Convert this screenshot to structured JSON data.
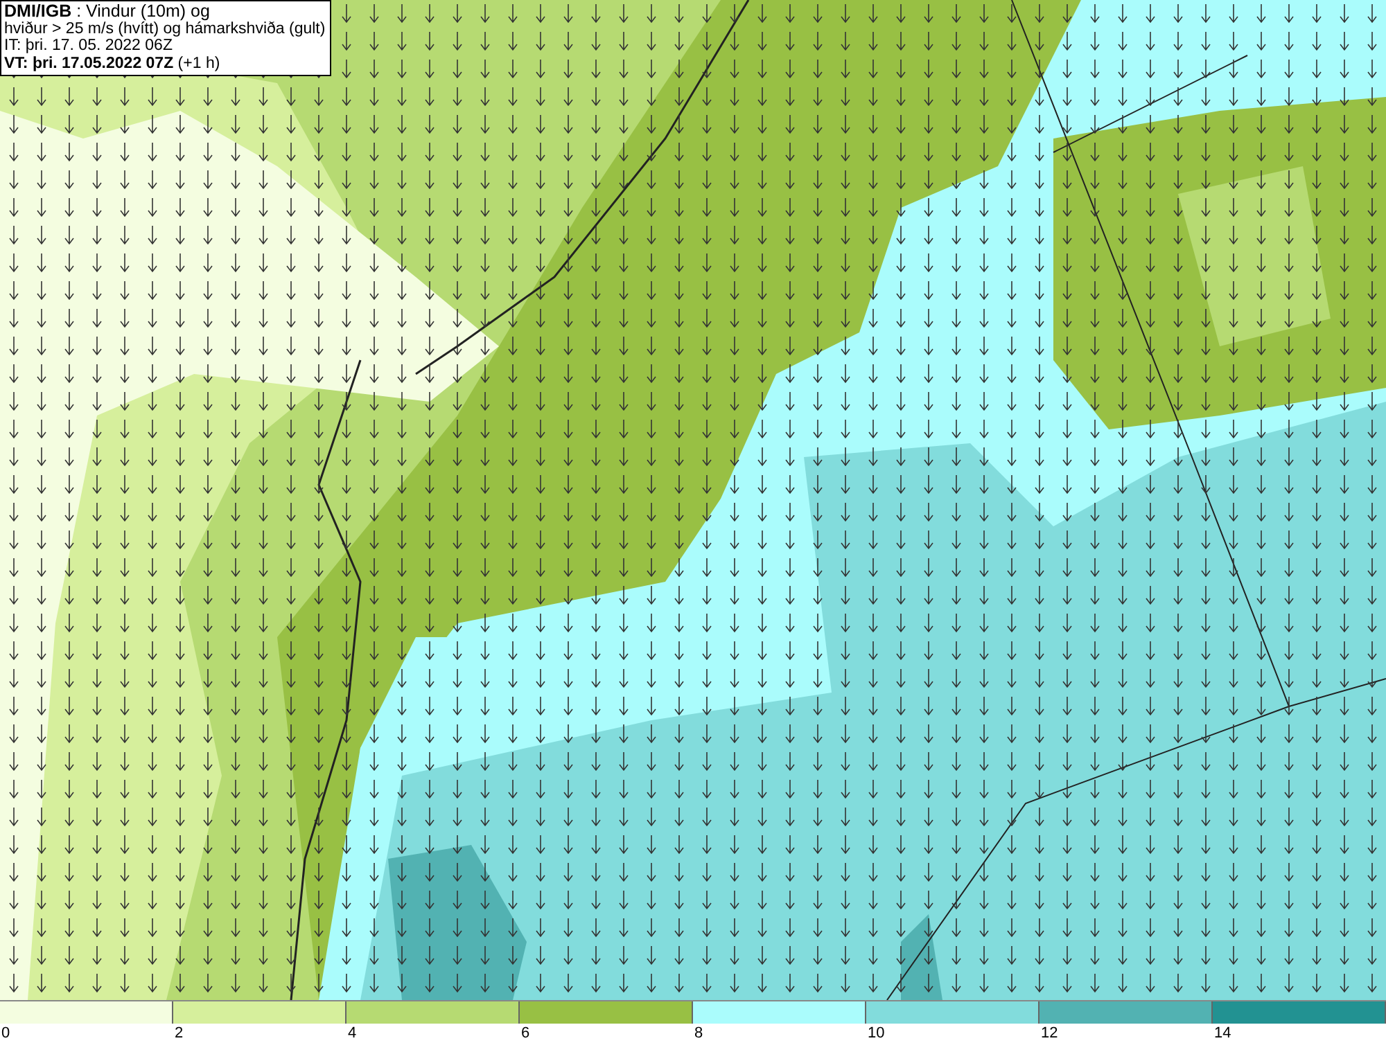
{
  "info_box": {
    "lines": [
      "**DMI/IGB** : Vindur (10m) og",
      "hviður > 25 m/s (hvítt) og hámarkshviða (gult)",
      "IT: þri. 17. 05. 2022 06Z",
      "**VT: þri. 17.05.2022 07Z** (+1 h)"
    ]
  },
  "legend": {
    "bins": [
      {
        "color": "#f4fde0"
      },
      {
        "color": "#d6ef9c"
      },
      {
        "color": "#b6da72"
      },
      {
        "color": "#98c044"
      },
      {
        "color": "#aafcfc"
      },
      {
        "color": "#82dcdc"
      },
      {
        "color": "#52b2b2"
      },
      {
        "color": "#229292"
      }
    ],
    "ticks": [
      "0",
      "2",
      "4",
      "6",
      "8",
      "10",
      "12",
      "14"
    ]
  }
}
